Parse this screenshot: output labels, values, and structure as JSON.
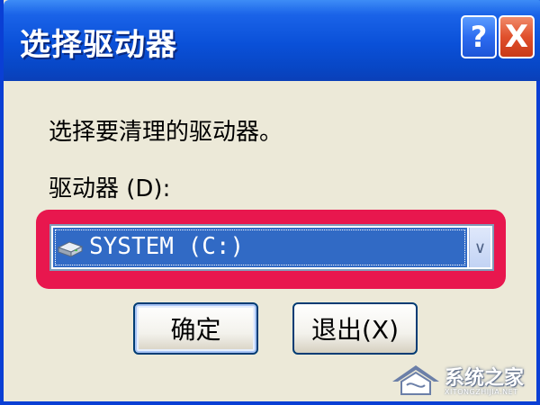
{
  "window": {
    "title": "选择驱动器",
    "help_glyph": "?",
    "close_glyph": "X"
  },
  "dialog": {
    "prompt": "选择要清理的驱动器。",
    "drive_label": "驱动器 (D):",
    "drive_select": {
      "selected_value": "SYSTEM (C:)",
      "icon": "hard-drive-icon"
    },
    "buttons": {
      "ok_label": "确定",
      "exit_label": "退出(X)"
    }
  },
  "watermark": {
    "text": "系统之家",
    "url": "XITONGZHIJIA.NET"
  },
  "colors": {
    "titlebar": "#0a50d8",
    "highlight": "#e8174e",
    "selection": "#316ac5",
    "dialog_bg": "#ece9d8"
  }
}
